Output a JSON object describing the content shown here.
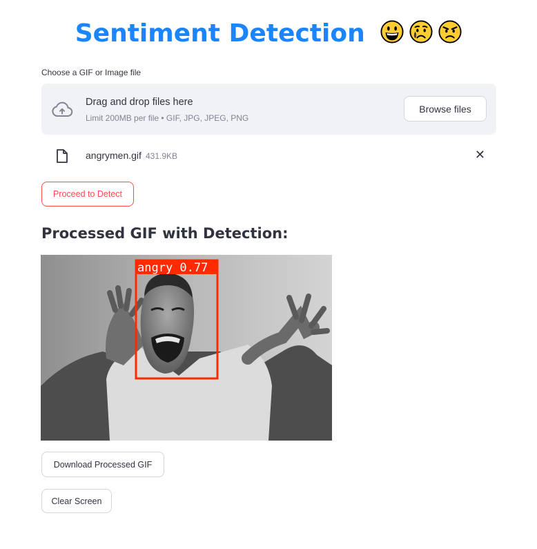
{
  "header": {
    "title": "Sentiment Detection",
    "emojis": [
      "grinning-face-icon",
      "crying-face-icon",
      "angry-face-icon"
    ],
    "title_color": "#1a85ff"
  },
  "uploader": {
    "label": "Choose a GIF or Image file",
    "drop_title": "Drag and drop files here",
    "drop_subtitle": "Limit 200MB per file • GIF, JPG, JPEG, PNG",
    "browse_label": "Browse files",
    "file": {
      "name": "angrymen.gif",
      "size": "431.9KB",
      "remove_glyph": "✕"
    }
  },
  "actions": {
    "detect_label": "Proceed to Detect",
    "detect_color": "#ff4b4b"
  },
  "result": {
    "heading": "Processed GIF with Detection:",
    "detection": {
      "label": "angry 0.77",
      "class": "angry",
      "confidence": 0.77,
      "box_color": "#ff2a00"
    },
    "download_label": "Download Processed GIF",
    "clear_label": "Clear Screen"
  }
}
